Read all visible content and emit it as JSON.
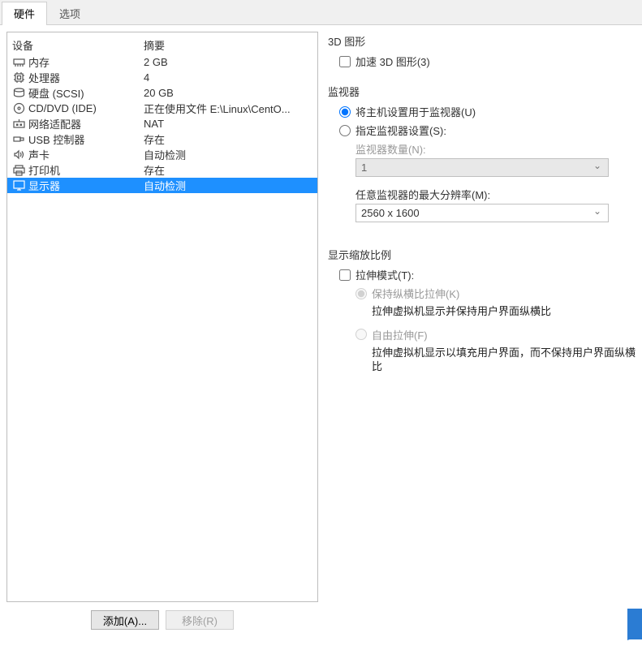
{
  "tabs": {
    "hardware": "硬件",
    "options": "选项"
  },
  "headers": {
    "device": "设备",
    "summary": "摘要"
  },
  "devices": [
    {
      "icon": "memory",
      "label": "内存",
      "summary": "2 GB"
    },
    {
      "icon": "cpu",
      "label": "处理器",
      "summary": "4"
    },
    {
      "icon": "disk",
      "label": "硬盘 (SCSI)",
      "summary": "20 GB"
    },
    {
      "icon": "cd",
      "label": "CD/DVD (IDE)",
      "summary": "正在使用文件 E:\\Linux\\CentO..."
    },
    {
      "icon": "network",
      "label": "网络适配器",
      "summary": "NAT"
    },
    {
      "icon": "usb",
      "label": "USB 控制器",
      "summary": "存在"
    },
    {
      "icon": "sound",
      "label": "声卡",
      "summary": "自动检测"
    },
    {
      "icon": "printer",
      "label": "打印机",
      "summary": "存在"
    },
    {
      "icon": "display",
      "label": "显示器",
      "summary": "自动检测"
    }
  ],
  "buttons": {
    "add": "添加(A)...",
    "remove": "移除(R)"
  },
  "panel": {
    "g3d": {
      "title": "3D 图形",
      "accel": "加速 3D 图形(3)"
    },
    "monitor": {
      "title": "监视器",
      "use_host": "将主机设置用于监视器(U)",
      "specify": "指定监视器设置(S):",
      "count_label": "监视器数量(N):",
      "count_value": "1",
      "maxres_label": "任意监视器的最大分辨率(M):",
      "maxres_value": "2560 x 1600"
    },
    "scale": {
      "title": "显示缩放比例",
      "stretch": "拉伸模式(T):",
      "keep_aspect": "保持纵横比拉伸(K)",
      "keep_desc": "拉伸虚拟机显示并保持用户界面纵横比",
      "free": "自由拉伸(F)",
      "free_desc": "拉伸虚拟机显示以填充用户界面，而不保持用户界面纵横比"
    }
  }
}
